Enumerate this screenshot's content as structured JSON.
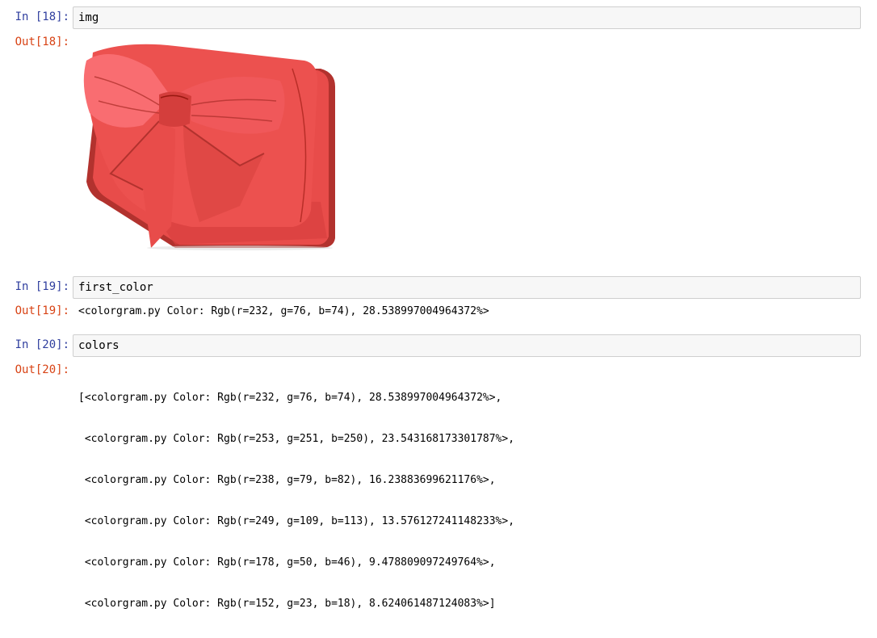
{
  "cells": [
    {
      "in_prompt": "In [18]:",
      "code": "img",
      "out_prompt": "Out[18]:",
      "output_image": "red-bow-clutch-bag-image"
    },
    {
      "in_prompt": "In [19]:",
      "code": "first_color",
      "out_prompt": "Out[19]:",
      "output_text": "<colorgram.py Color: Rgb(r=232, g=76, b=74), 28.538997004964372%>"
    },
    {
      "in_prompt": "In [20]:",
      "code": "colors",
      "out_prompt": "Out[20]:",
      "output_lines": [
        "[<colorgram.py Color: Rgb(r=232, g=76, b=74), 28.538997004964372%>,",
        " <colorgram.py Color: Rgb(r=253, g=251, b=250), 23.543168173301787%>,",
        " <colorgram.py Color: Rgb(r=238, g=79, b=82), 16.23883699621176%>,",
        " <colorgram.py Color: Rgb(r=249, g=109, b=113), 13.576127241148233%>,",
        " <colorgram.py Color: Rgb(r=178, g=50, b=46), 9.478809097249764%>,",
        " <colorgram.py Color: Rgb(r=152, g=23, b=18), 8.624061487124083%>]"
      ]
    }
  ],
  "colors": {
    "in_prompt": "#303f9f",
    "out_prompt": "#d84315",
    "input_bg": "#f7f7f7",
    "input_border": "#cfcfcf",
    "bag_main": "#e84c4a",
    "bag_dark": "#b2322e",
    "bag_shadow": "#98170f",
    "bag_light": "#f96d71"
  }
}
